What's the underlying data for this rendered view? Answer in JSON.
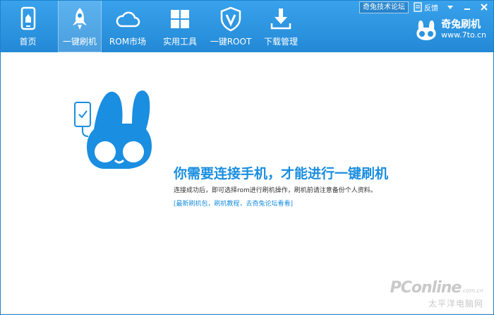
{
  "toolbar": {
    "items": [
      {
        "label": "首页",
        "icon": "home-phone-icon"
      },
      {
        "label": "一键刷机",
        "icon": "rocket-icon"
      },
      {
        "label": "ROM市场",
        "icon": "cloud-icon"
      },
      {
        "label": "实用工具",
        "icon": "grid-icon"
      },
      {
        "label": "一键ROOT",
        "icon": "shield-v-icon"
      },
      {
        "label": "下载管理",
        "icon": "download-icon"
      }
    ],
    "active_index": 1
  },
  "system": {
    "forum_label": "奇兔技术论坛",
    "feedback_label": "反馈",
    "feedback_icon": "feedback-icon",
    "settings_icon": "menu-caret-icon",
    "minimize_icon": "minimize-icon",
    "close_icon": "close-icon"
  },
  "brand": {
    "name": "奇兔刷机",
    "url": "www.7to.cn",
    "logo_icon": "rabbit-logo-icon"
  },
  "main": {
    "headline": "你需要连接手机，才能进行一键刷机",
    "description": "连接成功后，即可选择rom进行刷机操作，刷机前请注意备份个人资料。",
    "links_text": "[最新刷机包，刷机教程，去奇兔论坛看看]",
    "graphic_icon": "rabbit-phone-icon"
  },
  "watermark": {
    "main": "PConline",
    "domain": ".com.cn",
    "sub": "太平洋电脑网"
  },
  "colors": {
    "accent": "#1a8ee0",
    "toolbar": "#2b94e0"
  }
}
